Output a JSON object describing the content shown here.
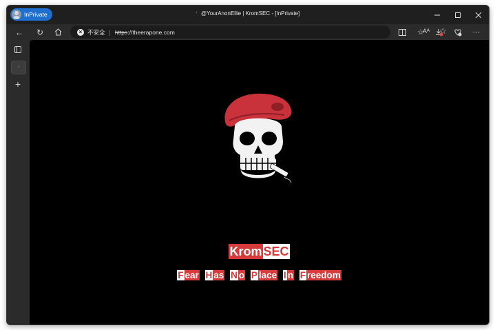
{
  "window": {
    "profile_label": "InPrivate",
    "tab_title": "@YourAnonEllie | KromSEC - [InPrivate]",
    "controls": {
      "minimize": "—",
      "maximize": "□",
      "close": "✕"
    }
  },
  "address": {
    "security_label": "不安全",
    "url_scheme": "https",
    "url_rest": "://theerapone.com",
    "read_aloud": "Aᴬ"
  },
  "icons": [
    "back-icon",
    "refresh-icon",
    "home-icon",
    "not-secure-icon",
    "read-aloud-icon",
    "favorite-star-icon",
    "split-screen-icon",
    "favorites-icon",
    "downloads-icon",
    "browser-essentials-icon",
    "more-icon",
    "tab-actions-icon",
    "new-tab-icon"
  ],
  "page": {
    "brand_part1": "Krom",
    "brand_part2": "SEC",
    "tagline": [
      {
        "first": "F",
        "rest": "ear"
      },
      {
        "first": "H",
        "rest": "as"
      },
      {
        "first": "N",
        "rest": "o"
      },
      {
        "first": "P",
        "rest": "lace"
      },
      {
        "first": "I",
        "rest": "n"
      },
      {
        "first": "F",
        "rest": "reedom"
      }
    ]
  },
  "colors": {
    "accent_red": "#d63a3a",
    "page_bg": "#000000",
    "chrome_bg": "#1f1f1f",
    "profile_blue": "#1f6fd1"
  }
}
